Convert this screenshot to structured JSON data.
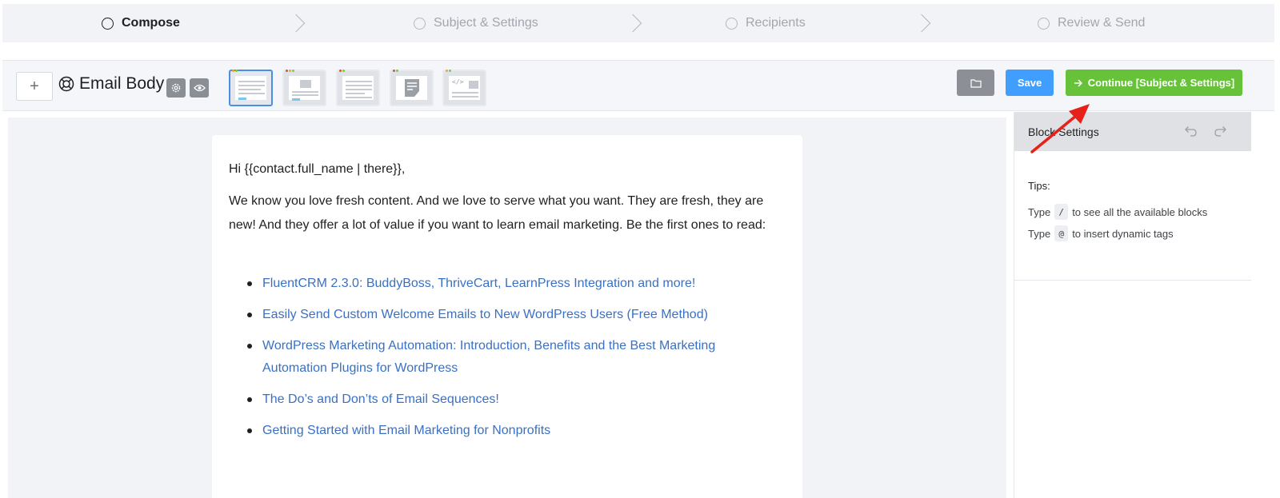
{
  "stepper": {
    "steps": [
      {
        "label": "Compose"
      },
      {
        "label": "Subject & Settings"
      },
      {
        "label": "Recipients"
      },
      {
        "label": "Review & Send"
      }
    ]
  },
  "toolbar": {
    "add_label": "+",
    "title": "Email Body",
    "save_label": "Save",
    "continue_label": "Continue [Subject & Settings]"
  },
  "email": {
    "greeting": "Hi {{contact.full_name | there}},",
    "paragraph": " We know you love fresh content. And we love to serve what you want. They are fresh,  they are new! And they offer a lot of value if you want to learn email marketing. Be the first ones to read:",
    "links": [
      "FluentCRM 2.3.0: BuddyBoss, ThriveCart, LearnPress Integration and more!",
      "Easily Send Custom Welcome Emails to New WordPress Users (Free Method)",
      "WordPress Marketing Automation: Introduction, Benefits and the Best Marketing Automation Plugins for WordPress",
      "The Do’s and Don’ts of Email Sequences!",
      "Getting Started with Email Marketing for Nonprofits"
    ]
  },
  "panel": {
    "title": "Block Settings",
    "tips_heading": "Tips:",
    "tip1": {
      "prefix": "Type",
      "key": "/",
      "suffix": "to see all the available blocks"
    },
    "tip2": {
      "prefix": "Type",
      "key": "@",
      "suffix": "to insert dynamic tags"
    }
  },
  "colors": {
    "save": "#409eff",
    "continue": "#67c23a",
    "link": "#3a70c4",
    "annotation_arrow": "#e8201a"
  },
  "icons": {
    "step": "circle-icon",
    "separator": "chevron-right-icon",
    "email_body": "lifebuoy-icon",
    "settings": "gear-icon",
    "preview": "eye-icon",
    "folder": "folder-icon",
    "continue": "arrow-right-icon",
    "undo": "undo-icon",
    "redo": "redo-icon"
  }
}
